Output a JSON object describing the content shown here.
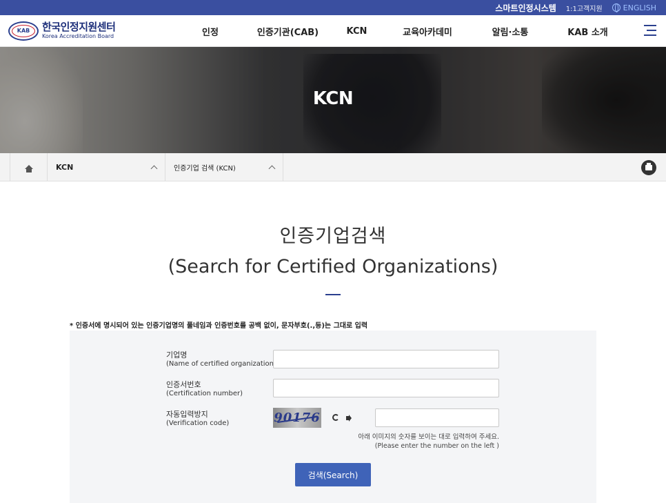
{
  "topbar": {
    "smart_system": "스마트인정시스템",
    "customer_support": "1:1고객지원",
    "english": "ENGLISH"
  },
  "header": {
    "logo_mark": "KAB",
    "logo_ko": "한국인정지원센터",
    "logo_en": "Korea Accreditation Board",
    "nav": [
      {
        "label": "인정"
      },
      {
        "label": "인증기관(CAB)"
      },
      {
        "label": "KCN"
      },
      {
        "label": "교육아카데미"
      },
      {
        "label": "알림·소통"
      },
      {
        "label": "KAB 소개"
      }
    ]
  },
  "hero": {
    "title": "KCN"
  },
  "breadcrumb": {
    "item1": "KCN",
    "item2": "인증기업 검색 (KCN)"
  },
  "page": {
    "title_ko": "인증기업검색",
    "title_en": "(Search for Certified Organizations)",
    "notice": "* 인증서에 명시되어 있는 인증기업명의 풀네임과 인증번호를 공백 없이, 문자부호(.,등)는 그대로 입력"
  },
  "form": {
    "org_label_ko": "기업명",
    "org_label_en": "(Name of certified organization)",
    "org_value": "",
    "cert_label_ko": "인증서번호",
    "cert_label_en": "(Certification number)",
    "cert_value": "",
    "code_label_ko": "자동입력방지",
    "code_label_en": "(Verification code)",
    "captcha_text": "90176",
    "code_value": "",
    "hint_ko": "아래 이미지의 숫자를 보이는 대로 입력하여 주세요.",
    "hint_en": "(Please enter the number on the left )",
    "search_label": "검색(Search)"
  },
  "colors": {
    "topbar": "#3a4fa0",
    "brand": "#2a3f8e",
    "button": "#3f63b8"
  }
}
